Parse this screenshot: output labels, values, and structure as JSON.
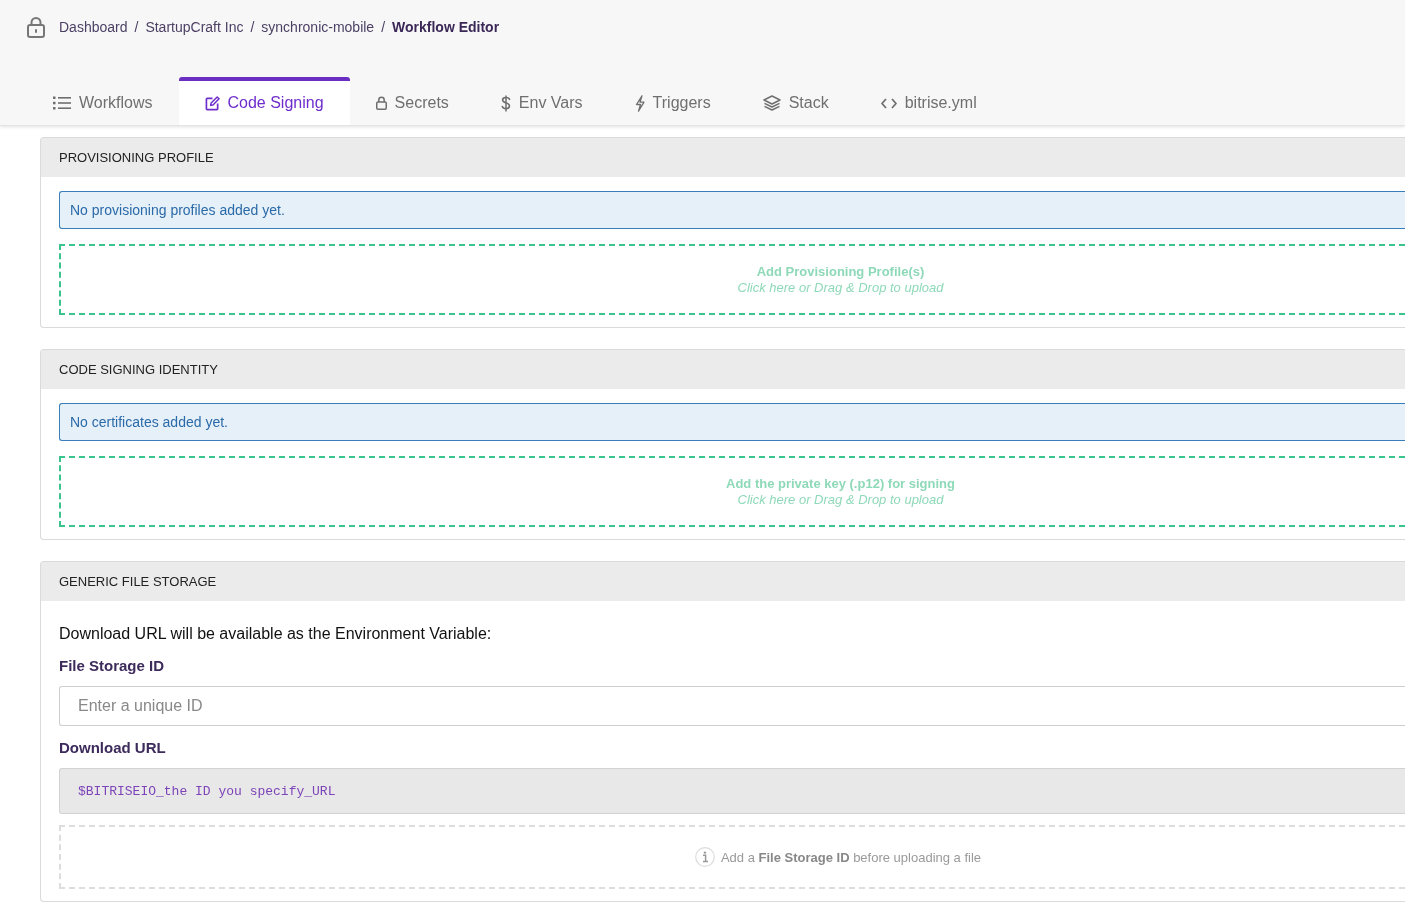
{
  "breadcrumb": {
    "items": [
      {
        "label": "Dashboard",
        "separator": "/",
        "current": false
      },
      {
        "label": "StartupCraft Inc",
        "separator": "/",
        "current": false
      },
      {
        "label": "synchronic-mobile",
        "separator": "/",
        "current": false
      },
      {
        "label": "Workflow Editor",
        "current": true
      }
    ]
  },
  "tabs": [
    {
      "label": "Workflows",
      "selected": false
    },
    {
      "label": "Code Signing",
      "selected": true
    },
    {
      "label": "Secrets",
      "selected": false
    },
    {
      "label": "Env Vars",
      "selected": false
    },
    {
      "label": "Triggers",
      "selected": false
    },
    {
      "label": "Stack",
      "selected": false
    },
    {
      "label": "bitrise.yml",
      "selected": false
    }
  ],
  "sections": [
    {
      "kind": "upload",
      "title": "PROVISIONING PROFILE",
      "notice": "No provisioning profiles added yet.",
      "upload": {
        "title": "Add Provisioning Profile(s)",
        "hint": "Click here or Drag & Drop to upload",
        "disabled": false
      }
    },
    {
      "kind": "upload",
      "title": "CODE SIGNING IDENTITY",
      "notice": "No certificates added yet.",
      "upload": {
        "title": "Add the private key (.p12) for signing",
        "hint": "Click here or Drag & Drop to upload",
        "disabled": false
      }
    },
    {
      "kind": "file_storage",
      "title": "GENERIC FILE STORAGE",
      "intro": "Download URL will be available as the Environment Variable:",
      "id_label": "File Storage ID",
      "id_field": {
        "placeholder": "Enter a unique ID"
      },
      "url_label": "Download URL",
      "url_value": "$BITRISEIO_the ID you specify_URL",
      "upload": {
        "hint": "Add a **File Storage ID** before uploading a file",
        "disabled": true
      }
    }
  ]
}
